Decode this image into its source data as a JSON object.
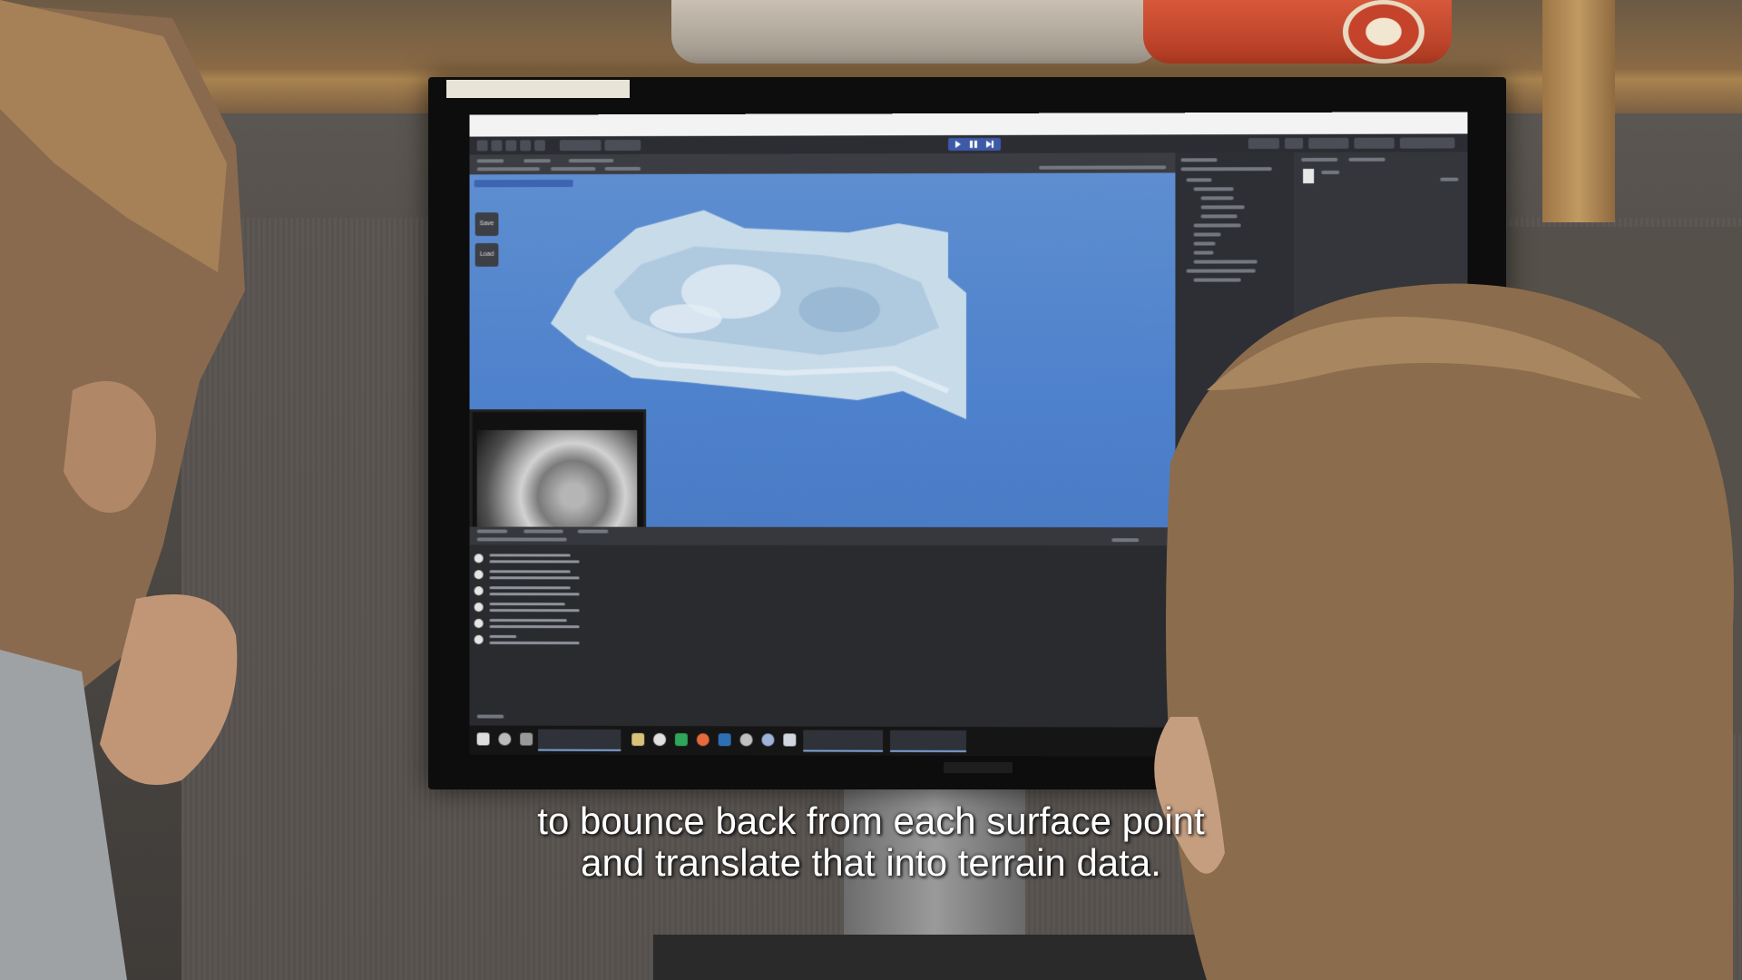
{
  "screen": {
    "scene": {
      "buttons": [
        {
          "label": "Save"
        },
        {
          "label": "Load"
        }
      ]
    }
  },
  "subtitle": {
    "line1": "to bounce back from each surface point",
    "line2": "and translate that into terrain data."
  }
}
